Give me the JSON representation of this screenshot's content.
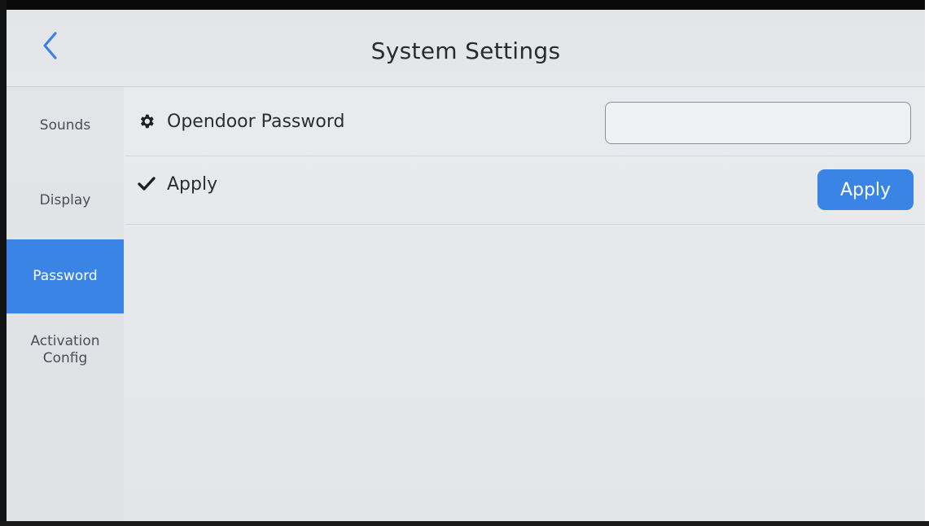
{
  "header": {
    "title": "System Settings",
    "back_icon": "chevron-left-icon"
  },
  "sidebar": {
    "items": [
      {
        "label": "Sounds",
        "active": false
      },
      {
        "label": "Display",
        "active": false
      },
      {
        "label": "Password",
        "active": true
      },
      {
        "label": "Activation Config",
        "active": false
      }
    ]
  },
  "settings": {
    "rows": [
      {
        "icon": "gear-icon",
        "label": "Opendoor Password",
        "control": "text-input",
        "value": "",
        "placeholder": ""
      },
      {
        "icon": "checkmark-icon",
        "label": "Apply",
        "control": "button",
        "button_label": "Apply"
      }
    ]
  },
  "colors": {
    "accent": "#3a84e6",
    "background": "#e7e9ed",
    "text": "#2b2b2b",
    "sidebar_text": "#4b4f55"
  }
}
